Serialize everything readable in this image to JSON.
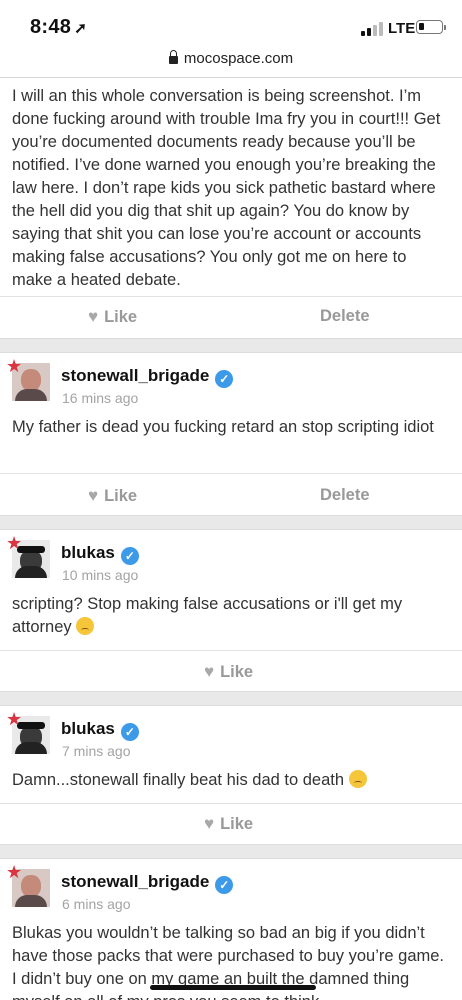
{
  "status_bar": {
    "time": "8:48",
    "network": "LTE",
    "battery_level": 0.25
  },
  "url_bar": {
    "url": "mocospace.com"
  },
  "posts": [
    {
      "body": "I will an this whole conversation is being screenshot. I’m done fucking around with trouble Ima fry you in court!!! Get you’re documented documents ready because you’ll be notified. I’ve done warned you enough you’re breaking the law here. I don’t rape kids you sick pathetic bastard where the hell did you dig that shit up again? You do know by saying that shit you can lose you’re account or accounts making false accusations? You only got me on here to make a heated debate.",
      "like": "Like",
      "delete": "Delete"
    },
    {
      "username": "stonewall_brigade",
      "time_ago": "16 mins ago",
      "body": "My father is dead you fucking retard an stop scripting idiot",
      "like": "Like",
      "delete": "Delete"
    },
    {
      "username": "blukas",
      "time_ago": "10 mins ago",
      "body": "scripting? Stop making false accusations or i'll get my attorney",
      "like": "Like"
    },
    {
      "username": "blukas",
      "time_ago": "7 mins ago",
      "body": "Damn...stonewall finally beat his dad to death",
      "like": "Like"
    },
    {
      "username": "stonewall_brigade",
      "time_ago": "6 mins ago",
      "body": "Blukas you wouldn’t be talking so bad an big if you didn’t have those packs that were purchased to buy you’re game. I didn’t buy one on my game an built the damned thing myself an all of my pros you seem to think"
    }
  ],
  "icons": {
    "location": "location-arrow-icon",
    "lock": "lock-icon",
    "heart": "heart-icon",
    "verified": "verified-badge-icon",
    "star": "star-icon",
    "emoji_laugh": "laughing-emoji-icon",
    "emoji_sad": "sad-emoji-icon"
  },
  "colors": {
    "verified": "#3d9ae8",
    "star": "#d93541",
    "action_text": "#999999",
    "timestamp": "#a3a3a3"
  }
}
